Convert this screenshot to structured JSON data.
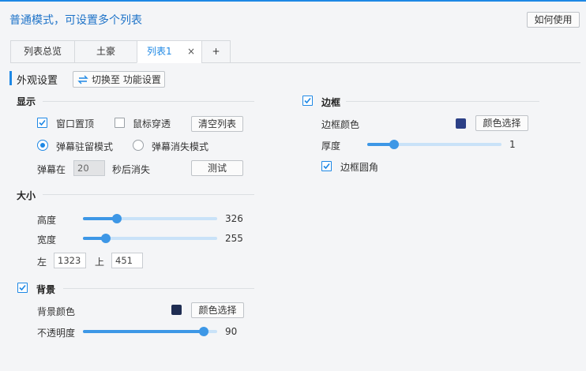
{
  "header": {
    "title": "普通模式，可设置多个列表",
    "help_label": "如何使用"
  },
  "tabs": [
    {
      "label": "列表总览"
    },
    {
      "label": "土豪"
    },
    {
      "label": "列表1",
      "close": "×"
    },
    {
      "label": "+"
    }
  ],
  "section": {
    "title": "外观设置",
    "switch_label": "切换至 功能设置"
  },
  "display": {
    "title": "显示",
    "window_top_label": "窗口置顶",
    "window_top_checked": true,
    "mouse_through_label": "鼠标穿透",
    "mouse_through_checked": false,
    "clear_list_label": "清空列表",
    "mode_stay_label": "弹幕驻留模式",
    "mode_fade_label": "弹幕消失模式",
    "selected_mode": "stay",
    "fade_prefix": "弹幕在",
    "fade_seconds": "20",
    "fade_suffix": "秒后消失",
    "test_label": "测试"
  },
  "size": {
    "title": "大小",
    "height_label": "高度",
    "height_value": "326",
    "height_fraction": 0.25,
    "width_label": "宽度",
    "width_value": "255",
    "width_fraction": 0.17,
    "left_label": "左",
    "left_value": "1323",
    "top_label": "上",
    "top_value": "451"
  },
  "background": {
    "title": "背景",
    "checked": true,
    "color_label": "背景颜色",
    "color": "#1f2d52",
    "pick_label": "颜色选择",
    "opacity_label": "不透明度",
    "opacity_value": "90",
    "opacity_fraction": 0.9
  },
  "border": {
    "title": "边框",
    "checked": true,
    "color_label": "边框颜色",
    "color": "#2b3f86",
    "pick_label": "颜色选择",
    "thickness_label": "厚度",
    "thickness_value": "1",
    "thickness_fraction": 0.2,
    "rounded_label": "边框圆角",
    "rounded_checked": true
  },
  "colors": {
    "accent": "#1e88e5",
    "track": "#c9e2f8"
  }
}
